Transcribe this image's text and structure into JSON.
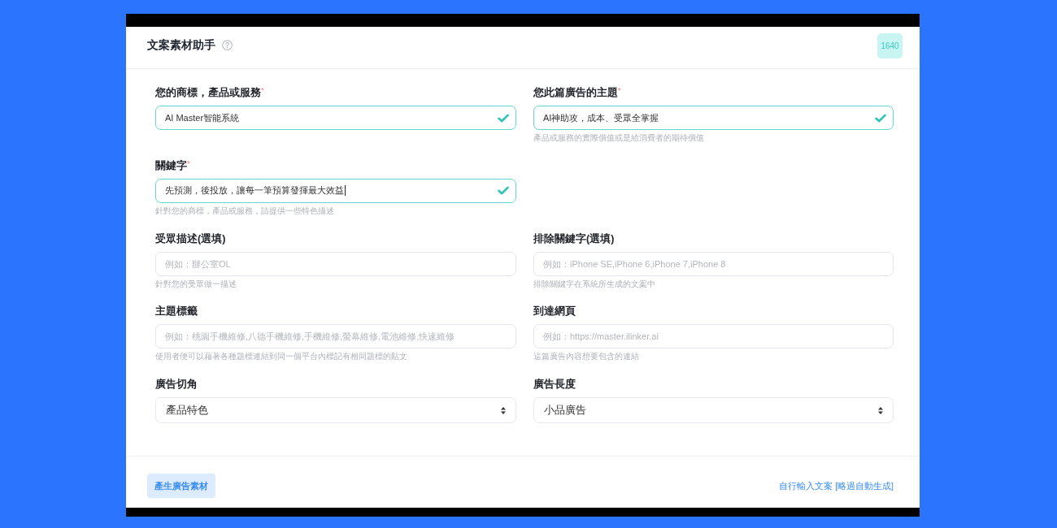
{
  "window": {
    "title": "文案素材助手",
    "badge": "1640"
  },
  "form": {
    "rows": [
      [
        {
          "kind": "text",
          "label": "您的商標，產品或服務$^{*}$",
          "value": "AI Master智能系統",
          "valid": true,
          "focused": false
        },
        {
          "kind": "text",
          "label": "您此篇廣告的主題$^{*}$",
          "value": "AI神助攻，成本、受眾全掌握",
          "hint": "產品或服務的實際價值或是給消費者的期待價值",
          "valid": true,
          "focused": false
        }
      ],
      [
        {
          "kind": "text",
          "label": "關鍵字$^{*}$",
          "value": "先預測，後投放，讓每一筆預算發揮最大效益",
          "hint": "針對您的商標，產品或服務，請提供一些特色描述",
          "valid": true,
          "focused": true
        }
      ],
      [
        {
          "kind": "text",
          "label": "受眾描述(選填)",
          "placeholder": "例如：辦公室OL",
          "hint": "針對您的受眾做一描述",
          "valid": false,
          "focused": false
        },
        {
          "kind": "text",
          "label": "排除關鍵字(選填)",
          "placeholder": "例如：iPhone SE,iPhone 6,iPhone 7,iPhone 8",
          "hint": "排除關鍵字在系統所生成的文案中",
          "valid": false,
          "focused": false
        }
      ],
      [
        {
          "kind": "text",
          "label": "主題標籤",
          "placeholder": "例如：桃園手機維修,八德手機維修,手機維修,螢幕維修,電池維修,快速維修",
          "hint": "使用者便可以藉著各種題標連結到同一個平台內標記有相同題標的貼文",
          "valid": false,
          "focused": false
        },
        {
          "kind": "text",
          "label": "到達網頁",
          "placeholder": "例如：https://master.ilinker.ai",
          "hint": "這篇廣告內容想要包含的連結",
          "valid": false,
          "focused": false
        }
      ],
      [
        {
          "kind": "select",
          "label": "廣告切角",
          "value": "產品特色"
        },
        {
          "kind": "select",
          "label": "廣告長度",
          "value": "小品廣告"
        }
      ]
    ]
  },
  "footer": {
    "primary_button": "產生廣告素材",
    "link": "自行輸入文案 [略過自動生成]"
  }
}
